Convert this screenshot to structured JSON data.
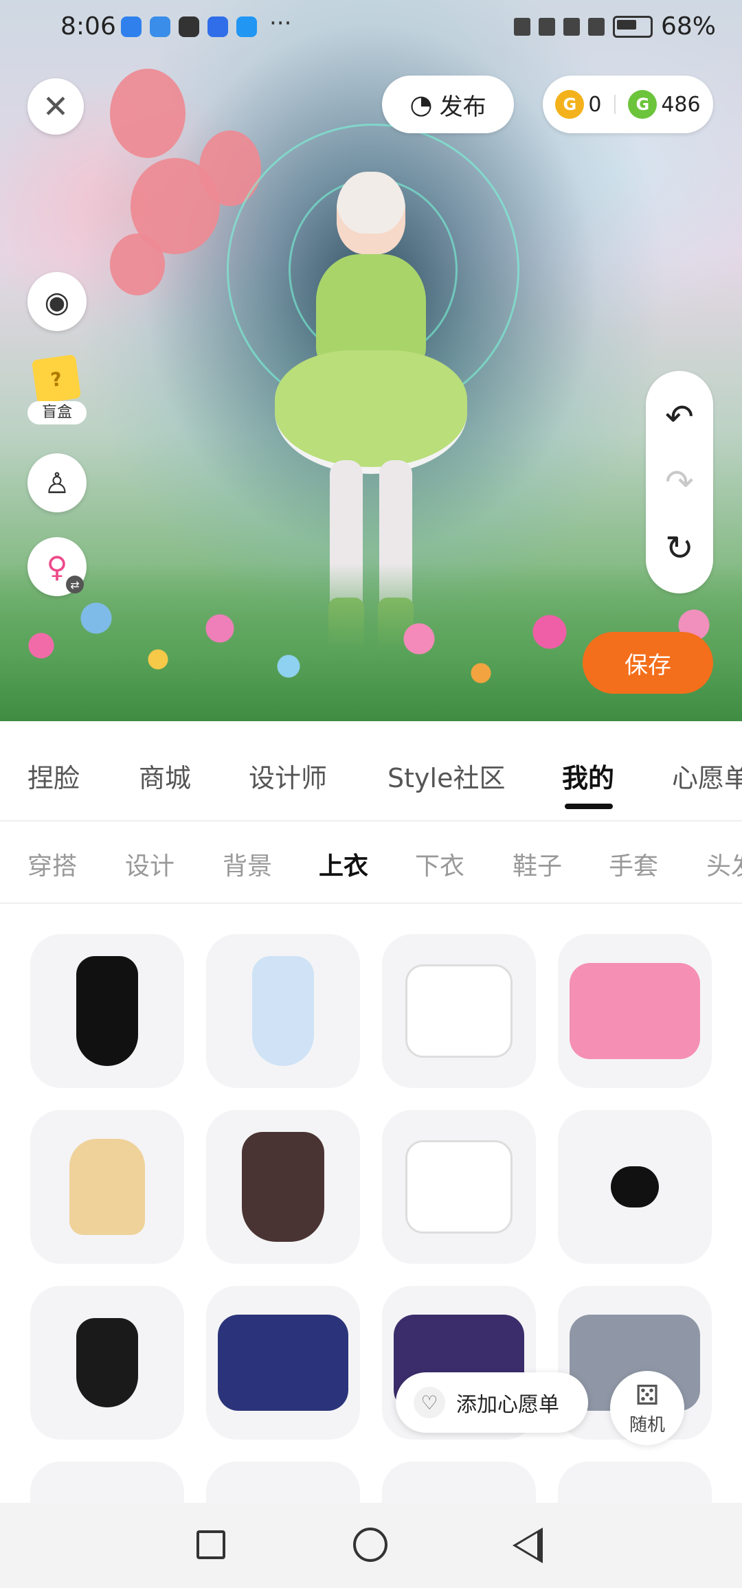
{
  "status_bar": {
    "time": "8:06",
    "more": "···",
    "battery": "68%"
  },
  "top": {
    "publish_label": "发布",
    "coins": [
      {
        "icon": "gold-coin-icon",
        "value": "0"
      },
      {
        "icon": "green-coin-icon",
        "value": "486"
      }
    ]
  },
  "left_tools": {
    "blindbox_label": "盲盒"
  },
  "save_label": "保存",
  "main_tabs": [
    {
      "label": "捏脸"
    },
    {
      "label": "商城"
    },
    {
      "label": "设计师"
    },
    {
      "label": "Style社区"
    },
    {
      "label": "我的",
      "active": true
    },
    {
      "label": "心愿单"
    }
  ],
  "sub_tabs": [
    {
      "label": "穿搭"
    },
    {
      "label": "设计"
    },
    {
      "label": "背景"
    },
    {
      "label": "上衣",
      "active": true
    },
    {
      "label": "下衣"
    },
    {
      "label": "鞋子"
    },
    {
      "label": "手套"
    },
    {
      "label": "头发"
    }
  ],
  "items": [
    {
      "name": "black-halter-dress",
      "color": "#111111"
    },
    {
      "name": "light-blue-dress",
      "color": "#cfe2f6"
    },
    {
      "name": "white-hoodie",
      "color": "#ffffff"
    },
    {
      "name": "pink-jacket",
      "color": "#f58fb3"
    },
    {
      "name": "beige-brown-outfit",
      "color": "#efd29a"
    },
    {
      "name": "brown-halter-dress",
      "color": "#4a3433"
    },
    {
      "name": "white-tshirt",
      "color": "#ffffff"
    },
    {
      "name": "black-hair-accessory",
      "color": "#111111"
    },
    {
      "name": "black-bodysuit",
      "color": "#1a1a1a"
    },
    {
      "name": "navy-blazer",
      "color": "#2b347a"
    },
    {
      "name": "purple-hoodie",
      "color": "#3b2d6b"
    },
    {
      "name": "gray-uniform",
      "color": "#8f97a6"
    }
  ],
  "wishlist_label": "添加心愿单",
  "random_label": "随机",
  "accent": "#f46f1b"
}
